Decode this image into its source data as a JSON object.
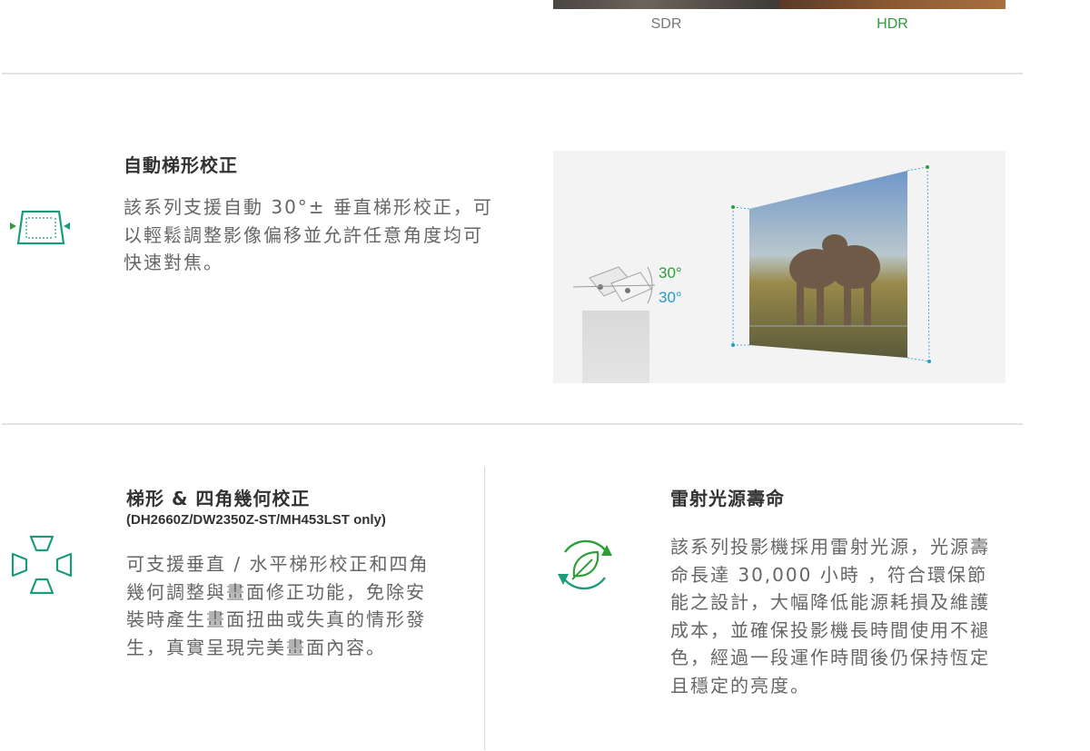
{
  "hdr_compare": {
    "sdr_label": "SDR",
    "hdr_label": "HDR",
    "sdr_color": "#777777",
    "hdr_color": "#2e9e3a"
  },
  "keystone": {
    "icon": "keystone-icon",
    "title": "自動梯形校正",
    "body": "該系列支援自動 30°± 垂直梯形校正，可以輕鬆調整影像偏移並允許任意角度均可快速對焦。",
    "illustration": {
      "angle_up": "30°",
      "angle_down": "30°",
      "angle_up_color": "#2e9e3a",
      "angle_down_color": "#1f9bd1"
    }
  },
  "corner_correction": {
    "icon": "four-corner-icon",
    "title": "梯形 & 四角幾何校正",
    "subtitle": "(DH2660Z/DW2350Z-ST/MH453LST only)",
    "body": "可支援垂直 / 水平梯形校正和四角幾何調整與畫面修正功能，免除安裝時產生畫面扭曲或失真的情形發生，真實呈現完美畫面內容。"
  },
  "laser_life": {
    "icon": "eco-leaf-icon",
    "title": "雷射光源壽命",
    "body": "該系列投影機採用雷射光源，光源壽命長達 30,000 小時 ，符合環保節能之設計，大幅降低能源耗損及維護成本，並確保投影機長時間使用不褪色，經過一段運作時間後仍保持恆定且穩定的亮度。"
  },
  "accent_color": "#2e9e3a",
  "teal_color": "#1a9b7b"
}
